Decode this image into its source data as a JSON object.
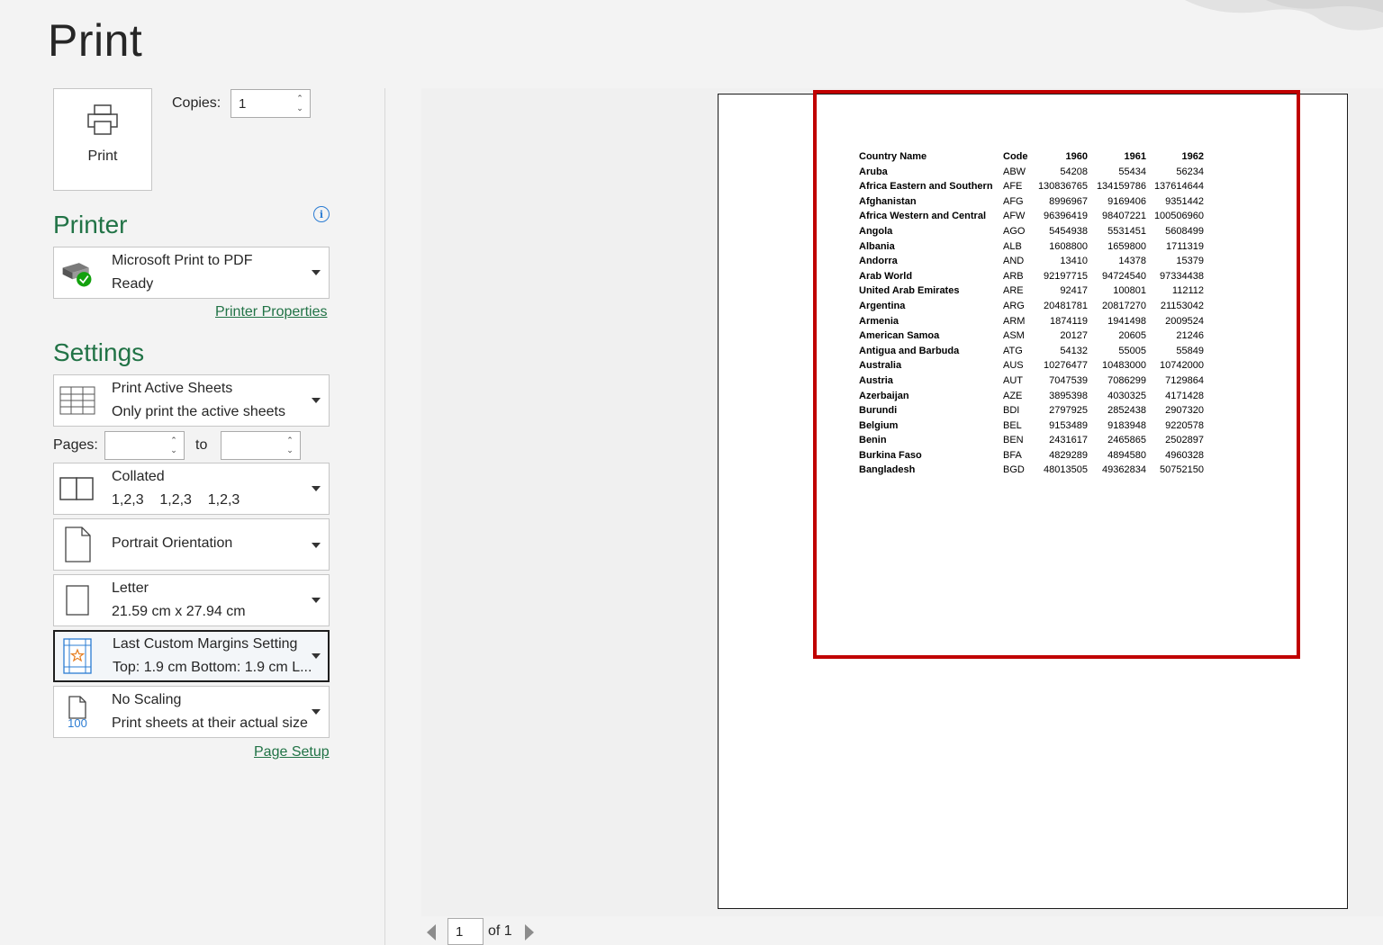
{
  "page_title": "Print",
  "print_button": {
    "label": "Print"
  },
  "copies": {
    "label": "Copies:",
    "value": "1"
  },
  "printer": {
    "heading": "Printer",
    "name": "Microsoft Print to PDF",
    "status": "Ready",
    "properties_link": "Printer Properties"
  },
  "settings": {
    "heading": "Settings",
    "what": {
      "title": "Print Active Sheets",
      "subtitle": "Only print the active sheets"
    },
    "pages": {
      "label": "Pages:",
      "from": "",
      "to_label": "to",
      "to": ""
    },
    "collation": {
      "title": "Collated",
      "subtitle": "1,2,3    1,2,3    1,2,3"
    },
    "orientation": {
      "title": "Portrait Orientation"
    },
    "paper": {
      "title": "Letter",
      "subtitle": "21.59 cm x 27.94 cm"
    },
    "margins": {
      "title": "Last Custom Margins Setting",
      "subtitle": "Top: 1.9 cm Bottom: 1.9 cm L..."
    },
    "scaling": {
      "title": "No Scaling",
      "subtitle": "Print sheets at their actual size",
      "icon_text": "100"
    },
    "page_setup_link": "Page Setup"
  },
  "preview": {
    "headers": [
      "Country Name",
      "Code",
      "1960",
      "1961",
      "1962"
    ],
    "rows": [
      [
        "Aruba",
        "ABW",
        "54208",
        "55434",
        "56234"
      ],
      [
        "Africa Eastern and Southern",
        "AFE",
        "130836765",
        "134159786",
        "137614644"
      ],
      [
        "Afghanistan",
        "AFG",
        "8996967",
        "9169406",
        "9351442"
      ],
      [
        "Africa Western and Central",
        "AFW",
        "96396419",
        "98407221",
        "100506960"
      ],
      [
        "Angola",
        "AGO",
        "5454938",
        "5531451",
        "5608499"
      ],
      [
        "Albania",
        "ALB",
        "1608800",
        "1659800",
        "1711319"
      ],
      [
        "Andorra",
        "AND",
        "13410",
        "14378",
        "15379"
      ],
      [
        "Arab World",
        "ARB",
        "92197715",
        "94724540",
        "97334438"
      ],
      [
        "United Arab Emirates",
        "ARE",
        "92417",
        "100801",
        "112112"
      ],
      [
        "Argentina",
        "ARG",
        "20481781",
        "20817270",
        "21153042"
      ],
      [
        "Armenia",
        "ARM",
        "1874119",
        "1941498",
        "2009524"
      ],
      [
        "American Samoa",
        "ASM",
        "20127",
        "20605",
        "21246"
      ],
      [
        "Antigua and Barbuda",
        "ATG",
        "54132",
        "55005",
        "55849"
      ],
      [
        "Australia",
        "AUS",
        "10276477",
        "10483000",
        "10742000"
      ],
      [
        "Austria",
        "AUT",
        "7047539",
        "7086299",
        "7129864"
      ],
      [
        "Azerbaijan",
        "AZE",
        "3895398",
        "4030325",
        "4171428"
      ],
      [
        "Burundi",
        "BDI",
        "2797925",
        "2852438",
        "2907320"
      ],
      [
        "Belgium",
        "BEL",
        "9153489",
        "9183948",
        "9220578"
      ],
      [
        "Benin",
        "BEN",
        "2431617",
        "2465865",
        "2502897"
      ],
      [
        "Burkina Faso",
        "BFA",
        "4829289",
        "4894580",
        "4960328"
      ],
      [
        "Bangladesh",
        "BGD",
        "48013505",
        "49362834",
        "50752150"
      ]
    ]
  },
  "nav": {
    "page": "1",
    "of_label": "of 1"
  },
  "colors": {
    "accent": "#217346",
    "highlight": "#c00000"
  }
}
